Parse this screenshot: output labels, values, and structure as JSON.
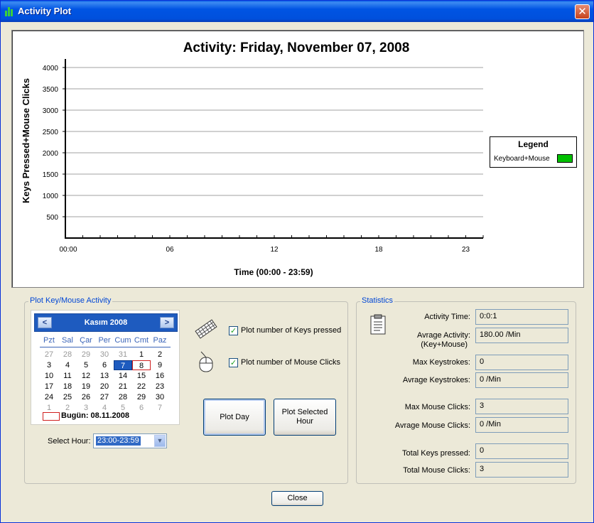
{
  "window": {
    "title": "Activity Plot",
    "close_glyph": "✕"
  },
  "chart_data": {
    "type": "line",
    "title": "Activity: Friday, November 07, 2008",
    "xlabel": "Time (00:00 - 23:59)",
    "ylabel": "Keys Pressed+Mouse Clicks",
    "x_ticks": [
      "00:00",
      "06",
      "12",
      "18",
      "23"
    ],
    "y_ticks": [
      500,
      1000,
      1500,
      2000,
      2500,
      3000,
      3500,
      4000
    ],
    "ylim": [
      0,
      4000
    ],
    "xlim": [
      0,
      24
    ],
    "grid": true,
    "legend": {
      "title": "Legend",
      "placement": "right",
      "entries": [
        {
          "name": "Keyboard+Mouse",
          "color": "#00C000"
        }
      ]
    },
    "series": [
      {
        "name": "Keyboard+Mouse",
        "x": [],
        "y": []
      }
    ]
  },
  "plot_group": {
    "title": "Plot Key/Mouse Activity",
    "calendar": {
      "month": "Kasım 2008",
      "prev": "<",
      "next": ">",
      "dow": [
        "Pzt",
        "Sal",
        "Çar",
        "Per",
        "Cum",
        "Cmt",
        "Paz"
      ],
      "weeks": [
        [
          [
            "27",
            1
          ],
          [
            "28",
            1
          ],
          [
            "29",
            1
          ],
          [
            "30",
            1
          ],
          [
            "31",
            1
          ],
          [
            "1",
            0
          ],
          [
            "2",
            0
          ]
        ],
        [
          [
            "3",
            0
          ],
          [
            "4",
            0
          ],
          [
            "5",
            0
          ],
          [
            "6",
            0
          ],
          [
            "7",
            2
          ],
          [
            "8",
            3
          ],
          [
            "9",
            0
          ]
        ],
        [
          [
            "10",
            0
          ],
          [
            "11",
            0
          ],
          [
            "12",
            0
          ],
          [
            "13",
            0
          ],
          [
            "14",
            0
          ],
          [
            "15",
            0
          ],
          [
            "16",
            0
          ]
        ],
        [
          [
            "17",
            0
          ],
          [
            "18",
            0
          ],
          [
            "19",
            0
          ],
          [
            "20",
            0
          ],
          [
            "21",
            0
          ],
          [
            "22",
            0
          ],
          [
            "23",
            0
          ]
        ],
        [
          [
            "24",
            0
          ],
          [
            "25",
            0
          ],
          [
            "26",
            0
          ],
          [
            "27",
            0
          ],
          [
            "28",
            0
          ],
          [
            "29",
            0
          ],
          [
            "30",
            0
          ]
        ],
        [
          [
            "1",
            1
          ],
          [
            "2",
            1
          ],
          [
            "3",
            1
          ],
          [
            "4",
            1
          ],
          [
            "5",
            1
          ],
          [
            "6",
            1
          ],
          [
            "7",
            1
          ]
        ]
      ],
      "today_label": "Bugün: 08.11.2008"
    },
    "select_hour_label": "Select Hour:",
    "select_hour_value": "23:00-23:59",
    "check_keys_label": "Plot number of Keys pressed",
    "check_mouse_label": "Plot number of Mouse Clicks",
    "check_mark": "✓",
    "plot_day_button": "Plot Day",
    "plot_hour_button_1": "Plot Selected",
    "plot_hour_button_2": "Hour"
  },
  "statistics": {
    "title": "Statistics",
    "activity_time_label": "Activity Time:",
    "activity_time": "0:0:1",
    "avg_activity_label_1": "Avrage Activity:",
    "avg_activity_label_2": "(Key+Mouse)",
    "avg_activity": "180.00 /Min",
    "max_keys_label": "Max Keystrokes:",
    "max_keys": "0",
    "avg_keys_label": "Avrage Keystrokes:",
    "avg_keys": "0 /Min",
    "max_clicks_label": "Max Mouse Clicks:",
    "max_clicks": "3",
    "avg_clicks_label": "Avrage Mouse Clicks:",
    "avg_clicks": "0 /Min",
    "total_keys_label": "Total Keys pressed:",
    "total_keys": "0",
    "total_clicks_label": "Total Mouse Clicks:",
    "total_clicks": "3"
  },
  "close_button": "Close"
}
